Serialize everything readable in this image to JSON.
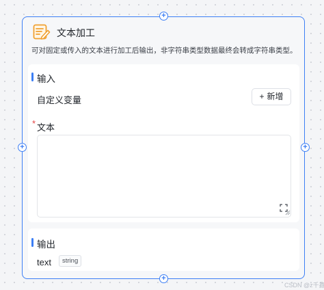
{
  "node": {
    "title": "文本加工",
    "description": "可对固定或传入的文本进行加工后输出，非字符串类型数据最终会转成字符串类型。",
    "icon": "edit-document-icon",
    "accent_color": "#3b7ef5",
    "icon_color": "#f0a030"
  },
  "input_section": {
    "title": "输入",
    "custom_variable_label": "自定义变量",
    "add_button_label": "新增",
    "add_button_icon": "plus-icon",
    "text_field_required_mark": "*",
    "text_field_label": "文本",
    "text_field_value": ""
  },
  "output_section": {
    "title": "输出",
    "variable_name": "text",
    "variable_type": "string"
  },
  "handles": {
    "symbol": "+"
  },
  "watermark": "CSDN @z千鑫"
}
